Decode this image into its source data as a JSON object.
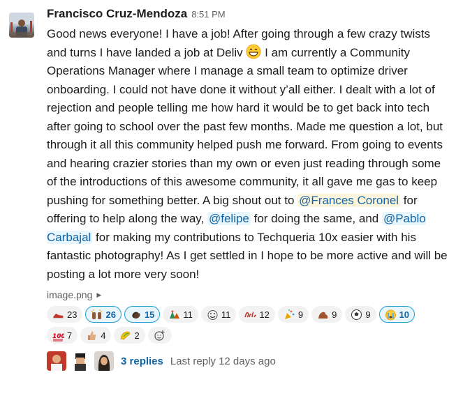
{
  "message": {
    "author": "Francisco Cruz-Mendoza",
    "time": "8:51 PM",
    "text": {
      "p1": "Good news everyone! I have a job! After going through a few crazy twists and turns I have landed a job at Deliv ",
      "p2": " I am currently a Community Operations Manager where I manage a small team to optimize driver onboarding. I could not have done it without y’all either. I dealt with a lot of rejection and people telling me how hard it would be to get back into tech after going to school over the past few months. Made me question a lot, but through it all this community helped push me forward. From going to events and hearing crazier stories than my own or even just reading through some of the introductions of this awesome community, it all gave me gas to keep pushing for something better. A big shout out to ",
      "m1": "@Frances Coronel",
      "p3": " for offering to help along the way, ",
      "m2": "@felipe",
      "p4": " for doing the same, and ",
      "m3": "@Pablo Carbajal",
      "p5": " for making my contributions to Techqueria 10x easier with his fantastic photography! As I get settled in I hope to be more active and will be posting a lot more very soon!"
    },
    "attachment": "image.png",
    "inline_emoji": "grinning-face"
  },
  "reactions": [
    {
      "icon": "sneaker-icon",
      "count": "23",
      "selected": false
    },
    {
      "icon": "raised-hands-icon",
      "count": "26",
      "selected": true
    },
    {
      "icon": "clapping-hands-icon",
      "count": "15",
      "selected": true
    },
    {
      "icon": "party-people-icon",
      "count": "11",
      "selected": false
    },
    {
      "icon": "party-face-icon",
      "count": "11",
      "selected": false
    },
    {
      "icon": "dale-icon",
      "count": "12",
      "selected": false
    },
    {
      "icon": "party-popper-icon",
      "count": "9",
      "selected": false
    },
    {
      "icon": "flexed-biceps-icon",
      "count": "9",
      "selected": false
    },
    {
      "icon": "soccer-icon",
      "count": "9",
      "selected": false
    },
    {
      "icon": "crying-face-icon",
      "count": "10",
      "selected": true
    },
    {
      "icon": "hundred-points-icon",
      "count": "7",
      "selected": false
    },
    {
      "icon": "thumbs-up-icon",
      "count": "4",
      "selected": false
    },
    {
      "icon": "taco-icon",
      "count": "2",
      "selected": false
    }
  ],
  "add_reaction_icon": "add-reaction-icon",
  "thread": {
    "replies": "3 replies",
    "last_reply": "Last reply 12 days ago"
  }
}
